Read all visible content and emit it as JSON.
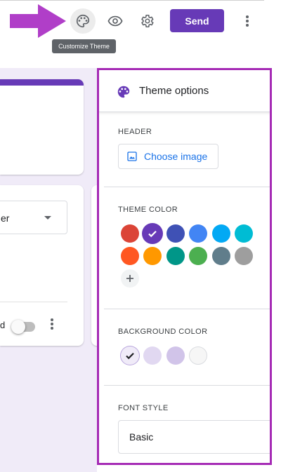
{
  "toolbar": {
    "send_label": "Send",
    "tooltip": "Customize Theme",
    "send_color": "#673ab7",
    "icons": [
      "palette-icon",
      "eye-icon",
      "gear-icon",
      "more-vert-icon"
    ]
  },
  "form": {
    "question_type_partial": "er",
    "required_partial": "d",
    "accent": "#673ab7",
    "background": "#f0ebf8"
  },
  "theme_panel": {
    "title": "Theme options",
    "header_label": "HEADER",
    "choose_image_label": "Choose image",
    "theme_color_label": "THEME COLOR",
    "theme_colors": [
      "#db4437",
      "#673ab7",
      "#3f51b5",
      "#4285f4",
      "#03a9f4",
      "#00bcd4",
      "#ff5722",
      "#ff9800",
      "#009688",
      "#4caf50",
      "#607d8b",
      "#9e9e9e"
    ],
    "selected_theme_color": "#673ab7",
    "background_color_label": "BACKGROUND COLOR",
    "background_colors": [
      "#f0ebf8",
      "#e1d8f1",
      "#d1c4e9",
      "#f6f6f6"
    ],
    "selected_background_color": "#f0ebf8",
    "font_style_label": "FONT STYLE",
    "font_style_value": "Basic"
  },
  "annotation": {
    "arrow_color": "#b03ec8",
    "highlight_border": "#a52ab5"
  }
}
